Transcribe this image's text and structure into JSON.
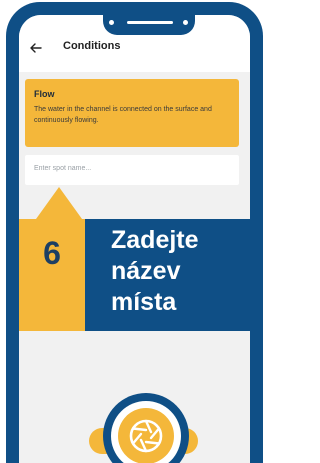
{
  "appbar": {
    "title": "Conditions",
    "back_icon": "arrow-left-icon"
  },
  "condition_card": {
    "title": "Flow",
    "description": "The water in the channel is connected on the surface and continuously flowing."
  },
  "spot_name_input": {
    "placeholder": "Enter spot name...",
    "value": ""
  },
  "step_callout": {
    "number": "6",
    "text": "Zadejte název místa"
  },
  "camera_button": {
    "icon": "camera-aperture-icon"
  },
  "colors": {
    "frame": "#0f4f86",
    "accent": "#f4b73a",
    "screen_bg": "#f1f1f1",
    "number_text": "#1d3f63"
  }
}
